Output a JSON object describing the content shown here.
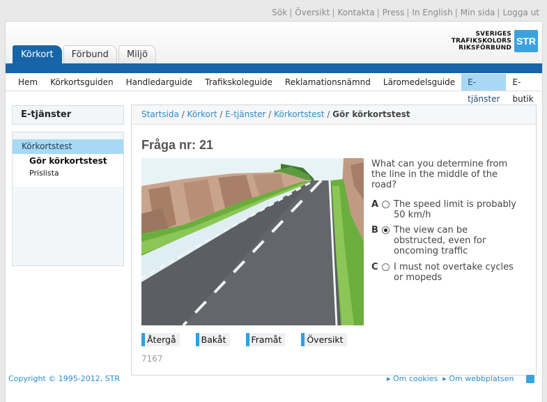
{
  "top_links": [
    "Sök",
    "Översikt",
    "Kontakta",
    "Press",
    "In English",
    "Min sida",
    "Logga ut"
  ],
  "tabs": [
    {
      "label": "Körkort",
      "active": true
    },
    {
      "label": "Förbund",
      "active": false
    },
    {
      "label": "Miljö",
      "active": false
    }
  ],
  "logo": {
    "line1": "SVERIGES",
    "line2": "TRAFIKSKOLORS",
    "line3": "RIKSFÖRBUND",
    "mark": "STR"
  },
  "nav": [
    "Hem",
    "Körkortsguiden",
    "Handledarguide",
    "Trafikskoleguide",
    "Reklamationsnämnd",
    "Läromedelsguide",
    "E-tjänster",
    "E-butik"
  ],
  "nav_active": "E-tjänster",
  "sidebar": {
    "title": "E-tjänster",
    "active_item": "Körkortstest",
    "sub_items": [
      "Gör körkortstest",
      "Prislista"
    ]
  },
  "breadcrumb": {
    "items": [
      "Startsida",
      "Körkort",
      "E-tjänster",
      "Körkortstest"
    ],
    "current": "Gör körkortstest"
  },
  "question": {
    "title": "Fråga nr: 21",
    "text": "What can you determine from the line in the middle of the road?",
    "options": [
      {
        "letter": "A",
        "text": "The speed limit is probably 50 km/h",
        "selected": false
      },
      {
        "letter": "B",
        "text": "The view can be obstructed, even for oncoming traffic",
        "selected": true
      },
      {
        "letter": "C",
        "text": "I must not overtake cycles or mopeds",
        "selected": false
      }
    ],
    "buttons": [
      "Återgå",
      "Bakåt",
      "Framåt",
      "Översikt"
    ],
    "code": "7167"
  },
  "footer": {
    "copyright": "Copyright © 1995-2012, STR",
    "links": [
      "Om cookies",
      "Om webbplatsen"
    ]
  },
  "colors": {
    "brand_blue": "#1765a8",
    "accent_blue": "#2a8ccf",
    "active_bg": "#a9d8f4"
  }
}
